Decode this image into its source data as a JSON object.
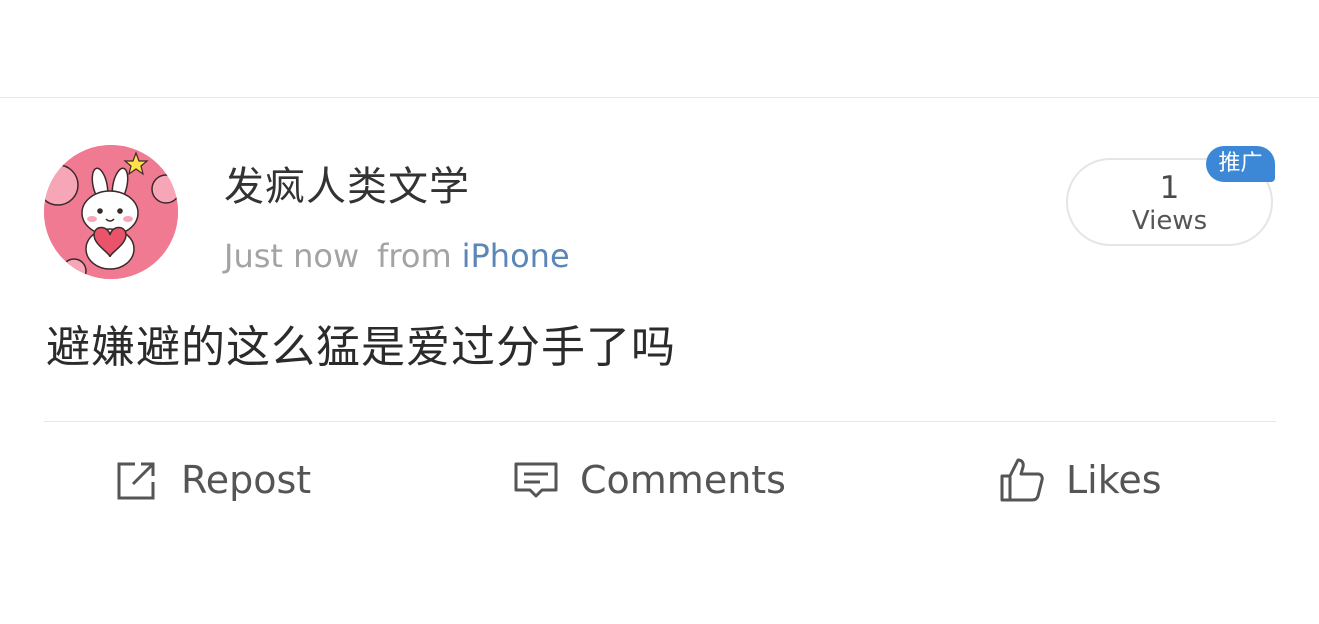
{
  "post": {
    "username": "发疯人类文学",
    "time": "Just now",
    "from_label": "from",
    "device": "iPhone",
    "text": "避嫌避的这么猛是爱过分手了吗"
  },
  "views": {
    "count": "1",
    "label": "Views",
    "promo_badge": "推广"
  },
  "actions": {
    "repost": "Repost",
    "comments": "Comments",
    "likes": "Likes"
  },
  "colors": {
    "link": "#5b86b8",
    "badge": "#3c88d6",
    "avatar_bg": "#f07a92"
  },
  "icons": {
    "avatar": "bunny-avatar",
    "repost": "repost-icon",
    "comments": "comment-icon",
    "likes": "thumbs-up-icon"
  }
}
